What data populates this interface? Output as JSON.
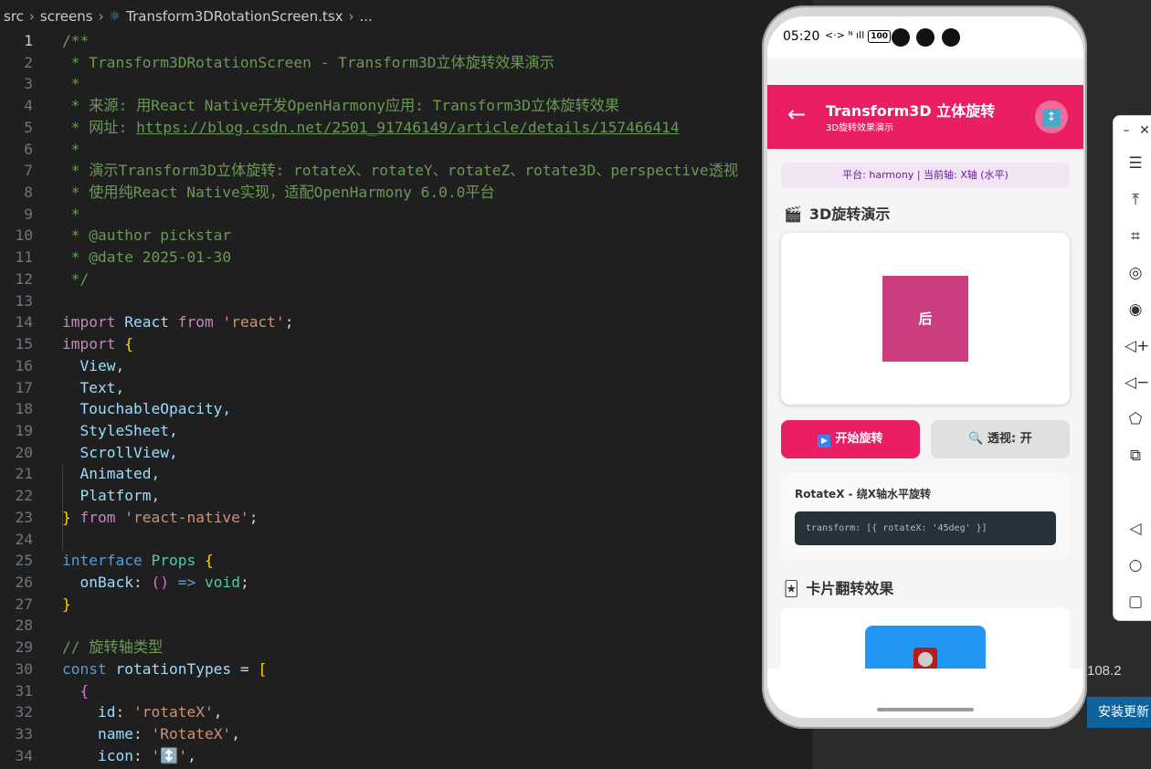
{
  "breadcrumb": {
    "root": "src",
    "folder": "screens",
    "file": "Transform3DRotationScreen.tsx",
    "tail": "..."
  },
  "code_lines": [
    {
      "n": "1"
    },
    {
      "n": "2"
    },
    {
      "n": "3"
    },
    {
      "n": "4"
    },
    {
      "n": "5"
    },
    {
      "n": "6"
    },
    {
      "n": "7"
    },
    {
      "n": "8"
    },
    {
      "n": "9"
    },
    {
      "n": "10"
    },
    {
      "n": "11"
    },
    {
      "n": "12"
    },
    {
      "n": "13"
    },
    {
      "n": "14"
    },
    {
      "n": "15"
    },
    {
      "n": "16"
    },
    {
      "n": "17"
    },
    {
      "n": "18"
    },
    {
      "n": "19"
    },
    {
      "n": "20"
    },
    {
      "n": "21"
    },
    {
      "n": "22"
    },
    {
      "n": "23"
    },
    {
      "n": "24"
    },
    {
      "n": "25"
    },
    {
      "n": "26"
    },
    {
      "n": "27"
    },
    {
      "n": "28"
    },
    {
      "n": "29"
    },
    {
      "n": "30"
    },
    {
      "n": "31"
    },
    {
      "n": "32"
    },
    {
      "n": "33"
    },
    {
      "n": "34"
    }
  ],
  "code": {
    "l1": "/**",
    "l2": " * Transform3DRotationScreen - Transform3D立体旋转效果演示",
    "l3": " *",
    "l4": " * 来源: 用React Native开发OpenHarmony应用: Transform3D立体旋转效果",
    "l5a": " * 网址: ",
    "l5b": "https://blog.csdn.net/2501_91746149/article/details/157466414",
    "l6": " *",
    "l7": " * 演示Transform3D立体旋转: rotateX、rotateY、rotateZ、rotate3D、perspective透视",
    "l8": " * 使用纯React Native实现，适配OpenHarmony 6.0.0平台",
    "l9": " *",
    "l10": " * @author pickstar",
    "l11": " * @date 2025-01-30",
    "l12": " */",
    "import": "import",
    "react": "React",
    "from": "from",
    "react_str": "'react'",
    "semi": ";",
    "lbrace": "{",
    "rbrace": "}",
    "i16": "View,",
    "i17": "Text,",
    "i18": "TouchableOpacity,",
    "i19": "StyleSheet,",
    "i20": "ScrollView,",
    "i21": "Animated,",
    "i22": "Platform,",
    "rn_str": "'react-native'",
    "interface": "interface",
    "props": "Props",
    "onback": "onBack",
    "colon": ": ",
    "parens": "()",
    "arrow": " => ",
    "void": "void",
    "l29": "// 旋转轴类型",
    "const": "const",
    "rotationTypes": "rotationTypes",
    "eq": " = ",
    "lbracket": "[",
    "id_key": "id",
    "id_val": "'rotateX'",
    "name_key": "name",
    "name_val": "'RotateX'",
    "icon_key": "icon",
    "icon_val": "'↕️'",
    "comma": ","
  },
  "phone": {
    "status": {
      "time": "05:20",
      "icons": "<·> ᴺ ıll",
      "battery": "100"
    },
    "header": {
      "back": "←",
      "title": "Transform3D 立体旋转",
      "subtitle": "3D旋转效果演示",
      "button_icon": "↕"
    },
    "platform_text": "平台: harmony | 当前轴: X轴 (水平)",
    "section1": {
      "icon": "🎬",
      "title": "3D旋转演示"
    },
    "box_label": "后",
    "start_button": {
      "icon": "▶",
      "label": "开始旋转"
    },
    "perspective_button": {
      "icon": "🔍",
      "label": "透视: 开"
    },
    "info": {
      "title": "RotateX - 绕X轴水平旋转",
      "code": "transform: [{ rotateX: '45deg' }]"
    },
    "section2": {
      "icon": "🃏",
      "title": "卡片翻转效果"
    }
  },
  "behind": {
    "version": "108.2",
    "install_button": "安装更新"
  },
  "colors": {
    "accent": "#e91e63",
    "editor_bg": "#1f1f1f",
    "comment": "#6a9955"
  }
}
